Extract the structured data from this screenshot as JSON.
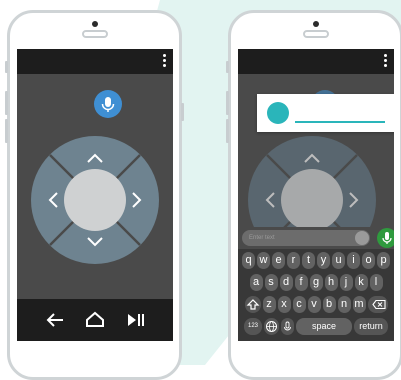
{
  "colors": {
    "background_shape": "#e2f4f1",
    "phone_frame": "#cfd4d6",
    "screen": "#4a4a4a",
    "dpad_outer": "#6e8390",
    "dpad_inner": "#cfd1d2",
    "mic_blue": "#3f8fd3",
    "mic_green": "#2f9a3e",
    "accent_teal": "#2ab5ba"
  },
  "left_phone": {
    "mic_icon": "microphone-icon",
    "dpad_icons": [
      "chevron-up-icon",
      "chevron-right-icon",
      "chevron-down-icon",
      "chevron-left-icon"
    ],
    "nav_icons": [
      "back-arrow-icon",
      "home-icon",
      "play-pause-icon"
    ]
  },
  "right_phone": {
    "search_placeholder": "Enter text",
    "keyboard": {
      "row1": [
        "q",
        "w",
        "e",
        "r",
        "t",
        "y",
        "u",
        "i",
        "o",
        "p"
      ],
      "row2": [
        "a",
        "s",
        "d",
        "f",
        "g",
        "h",
        "j",
        "k",
        "l"
      ],
      "row3": [
        "z",
        "x",
        "c",
        "v",
        "b",
        "n",
        "m"
      ],
      "numbers_key": "123",
      "space_key": "space",
      "return_key": "return"
    }
  }
}
